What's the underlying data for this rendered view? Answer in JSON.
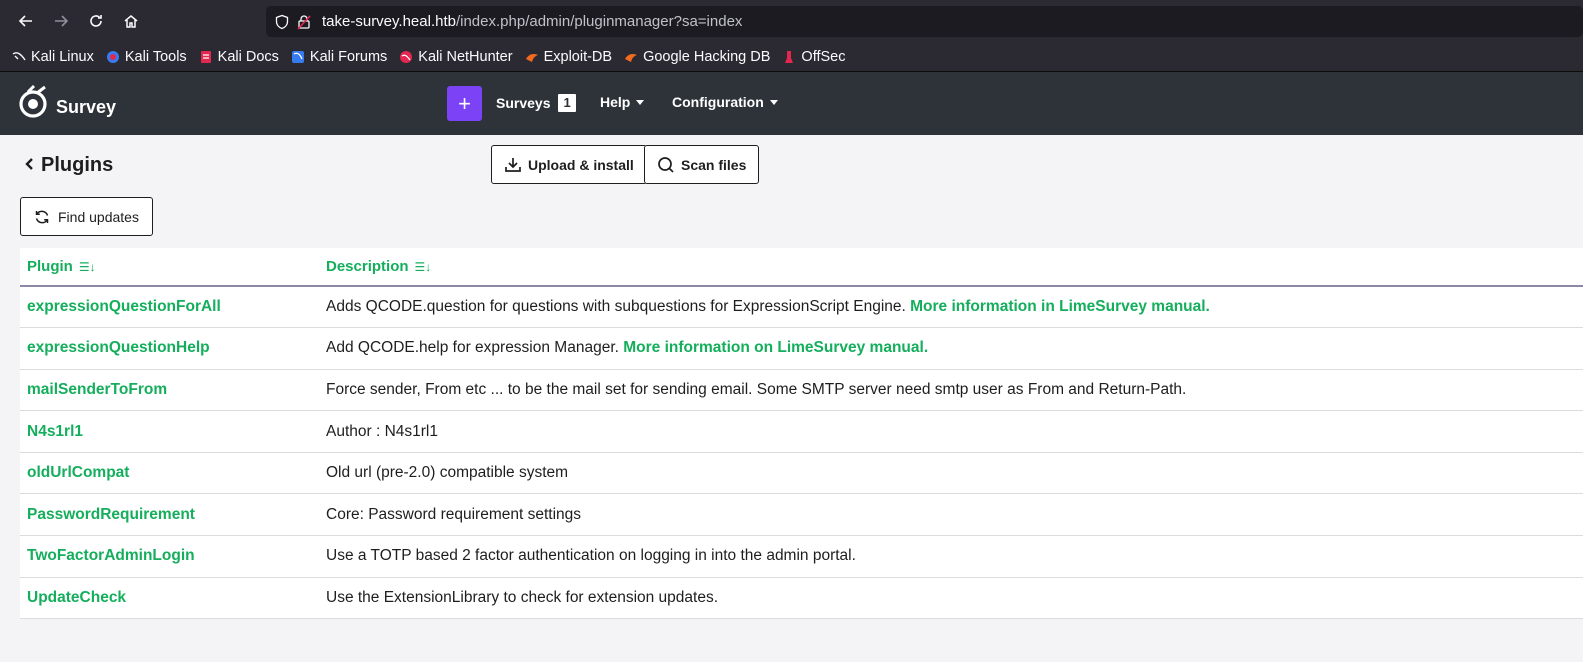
{
  "browser": {
    "url_host": "take-survey.heal.htb",
    "url_path": "/index.php/admin/pluginmanager?sa=index",
    "bookmarks": [
      "Kali Linux",
      "Kali Tools",
      "Kali Docs",
      "Kali Forums",
      "Kali NetHunter",
      "Exploit-DB",
      "Google Hacking DB",
      "OffSec"
    ]
  },
  "app": {
    "brand": "Survey",
    "accent": "#7b42f6",
    "nav": {
      "surveys_label": "Surveys",
      "surveys_count": "1",
      "help_label": "Help",
      "config_label": "Configuration"
    }
  },
  "page": {
    "title": "Plugins",
    "upload_label": "Upload & install",
    "scan_label": "Scan files",
    "find_updates_label": "Find updates",
    "table": {
      "headers": [
        "Plugin",
        "Description"
      ],
      "rows": [
        {
          "name": "expressionQuestionForAll",
          "desc": "Adds QCODE.question for questions with subquestions for ExpressionScript Engine.",
          "link": "More information in LimeSurvey manual."
        },
        {
          "name": "expressionQuestionHelp",
          "desc": "Add QCODE.help for expression Manager.",
          "link": "More information on LimeSurvey manual."
        },
        {
          "name": "mailSenderToFrom",
          "desc": "Force sender, From etc ... to be the mail set for sending email. Some SMTP server need smtp user as From and Return-Path.",
          "link": ""
        },
        {
          "name": "N4s1rl1",
          "desc": "Author : N4s1rl1",
          "link": ""
        },
        {
          "name": "oldUrlCompat",
          "desc": "Old url (pre-2.0) compatible system",
          "link": ""
        },
        {
          "name": "PasswordRequirement",
          "desc": "Core: Password requirement settings",
          "link": ""
        },
        {
          "name": "TwoFactorAdminLogin",
          "desc": "Use a TOTP based 2 factor authentication on logging in into the admin portal.",
          "link": ""
        },
        {
          "name": "UpdateCheck",
          "desc": "Use the ExtensionLibrary to check for extension updates.",
          "link": ""
        }
      ]
    }
  }
}
